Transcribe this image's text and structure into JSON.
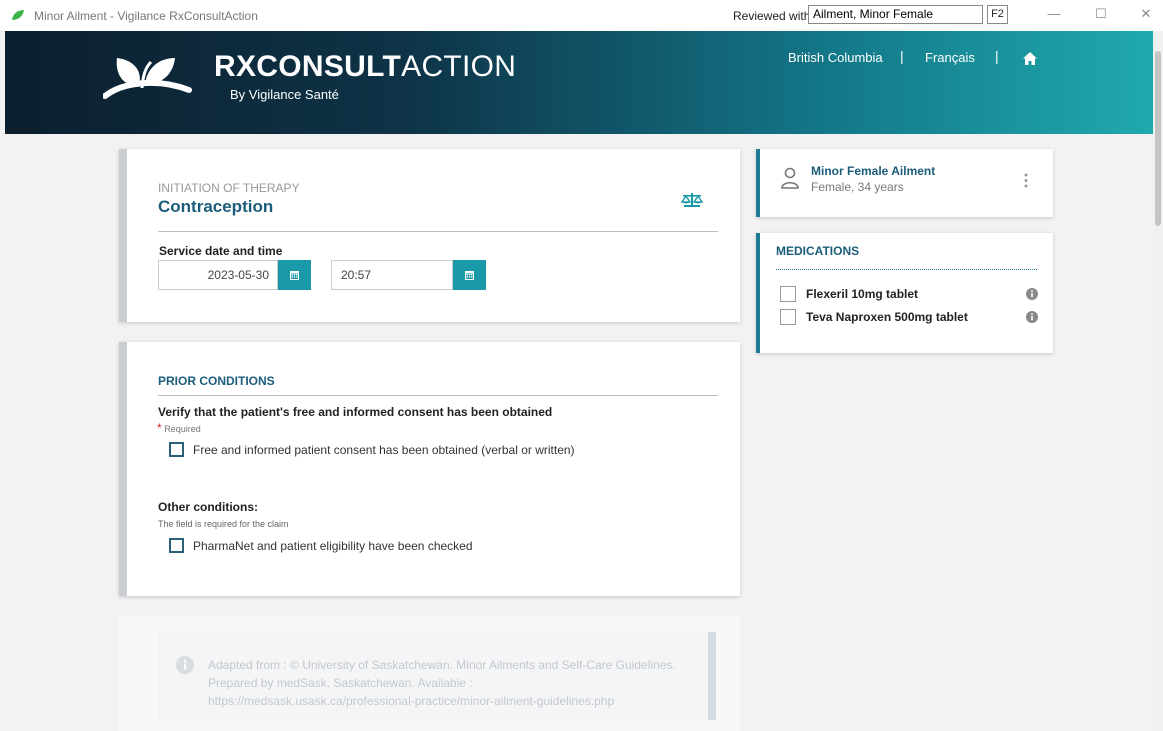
{
  "window": {
    "title": "Minor Ailment - Vigilance RxConsultAction",
    "reviewed_label": "Reviewed with",
    "reviewed_value": "Ailment, Minor Female",
    "shortcut": "F2",
    "minimize_glyph": "—",
    "maximize_glyph": "☐",
    "close_glyph": "✕"
  },
  "header": {
    "brand_bold": "RXCONSULT",
    "brand_light": "ACTION",
    "byline": "By Vigilance Santé",
    "nav": {
      "province": "British Columbia",
      "language": "Français",
      "sep": "|"
    },
    "home_icon": "home-icon"
  },
  "therapy": {
    "kicker": "INITIATION OF THERAPY",
    "title": "Contraception",
    "date_label": "Service date and time",
    "date_value": "2023-05-30",
    "time_value": "20:57",
    "balance_icon": "balance-scale-icon"
  },
  "prior": {
    "section_title": "PRIOR CONDITIONS",
    "consent_question": "Verify that the patient's free and informed consent has been obtained",
    "required_star": "*",
    "required_text": "Required",
    "consent_option": "Free and informed patient consent has been obtained (verbal or written)",
    "other_title": "Other conditions:",
    "other_help": "The field is required for the claim",
    "other_option": "PharmaNet and patient eligibility have been checked"
  },
  "reference": {
    "line1": "Adapted from : © University of Saskatchewan. Minor Ailments and Self-Care Guidelines.",
    "line2": "Prepared by medSask. Saskatchewan. Available :",
    "line3": "https://medsask.usask.ca/professional-practice/minor-ailment-guidelines.php"
  },
  "patient": {
    "name": "Minor Female Ailment",
    "details": "Female, 34 years"
  },
  "medications": {
    "title": "MEDICATIONS",
    "items": [
      {
        "label": "Flexeril 10mg tablet",
        "checked": false
      },
      {
        "label": "Teva Naproxen 500mg tablet",
        "checked": false
      }
    ]
  },
  "colors": {
    "accent": "#1a9aa8",
    "heading": "#1c5d7b",
    "banner_dark": "#0c1f2e",
    "banner_light": "#20a9ad"
  }
}
